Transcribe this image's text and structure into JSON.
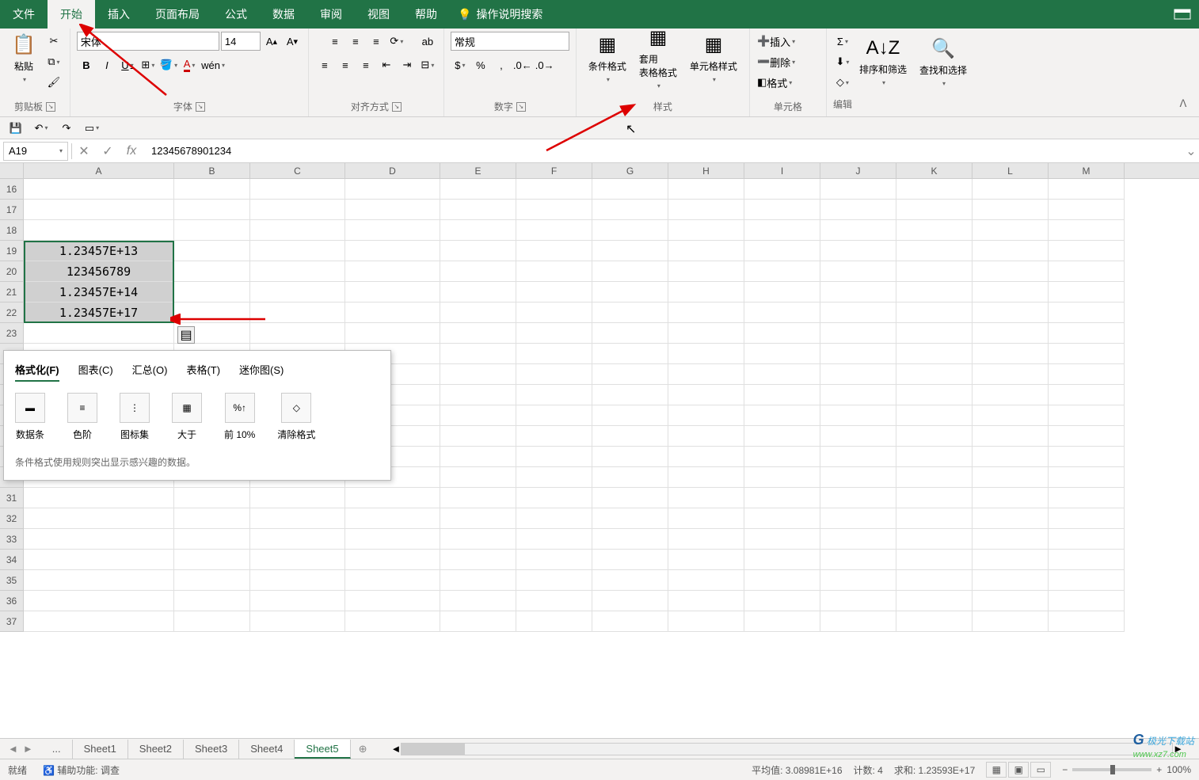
{
  "menubar": {
    "tabs": [
      "文件",
      "开始",
      "插入",
      "页面布局",
      "公式",
      "数据",
      "审阅",
      "视图",
      "帮助"
    ],
    "active": 1,
    "tell": "操作说明搜索"
  },
  "ribbon": {
    "clipboard": {
      "paste": "粘贴",
      "label": "剪贴板"
    },
    "font": {
      "name": "宋体",
      "size": "14",
      "bold": "B",
      "italic": "I",
      "underline": "U",
      "label": "字体"
    },
    "align": {
      "label": "对齐方式",
      "wrap": "ab"
    },
    "number": {
      "format": "常规",
      "label": "数字"
    },
    "styles": {
      "cond": "条件格式",
      "table": "套用\n表格格式",
      "cell": "单元格样式",
      "label": "样式"
    },
    "cells": {
      "insert": "插入",
      "delete": "删除",
      "format": "格式",
      "label": "单元格"
    },
    "editing": {
      "sort": "排序和筛选",
      "find": "查找和选择",
      "label": "编辑"
    }
  },
  "formula_bar": {
    "ref": "A19",
    "value": "12345678901234"
  },
  "columns": [
    "A",
    "B",
    "C",
    "D",
    "E",
    "F",
    "G",
    "H",
    "I",
    "J",
    "K",
    "L",
    "M"
  ],
  "rows_start": 16,
  "rows_end": 37,
  "cells": {
    "A19": "1.23457E+13",
    "A20": "123456789",
    "A21": "1.23457E+14",
    "A22": "1.23457E+17"
  },
  "popup": {
    "tabs": [
      "格式化(F)",
      "图表(C)",
      "汇总(O)",
      "表格(T)",
      "迷你图(S)"
    ],
    "active": 0,
    "options": [
      "数据条",
      "色阶",
      "图标集",
      "大于",
      "前 10%",
      "清除格式"
    ],
    "desc": "条件格式使用规则突出显示感兴趣的数据。"
  },
  "sheets": {
    "list": [
      "...",
      "Sheet1",
      "Sheet2",
      "Sheet3",
      "Sheet4",
      "Sheet5"
    ],
    "active": 5
  },
  "status": {
    "ready": "就绪",
    "access": "辅助功能: 调查",
    "avg": "平均值: 3.08981E+16",
    "count": "计数: 4",
    "sum": "求和: 1.23593E+17",
    "zoom": "100%"
  },
  "watermark": {
    "brand": "极光下载站",
    "url": "www.xz7.com"
  }
}
